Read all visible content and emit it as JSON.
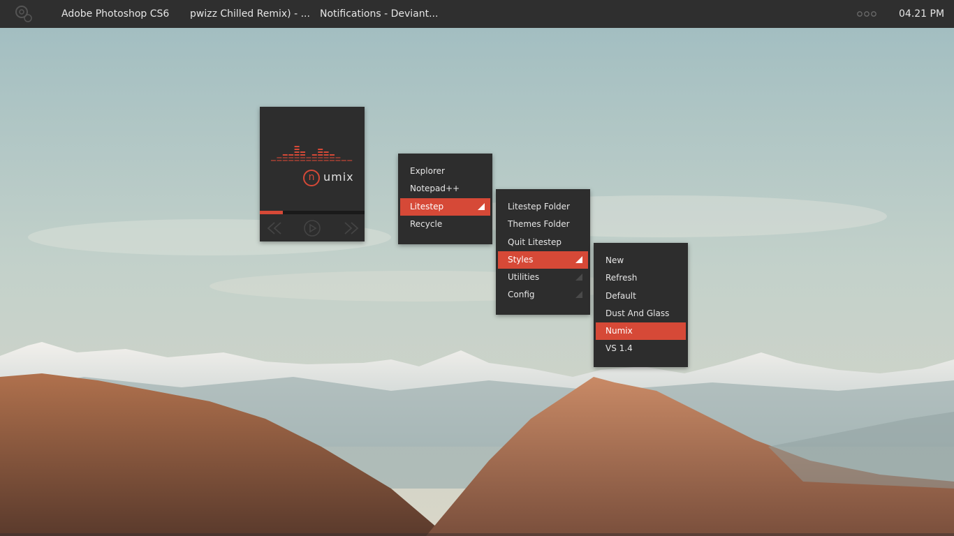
{
  "topbar": {
    "tasks": [
      "Adobe Photoshop CS6",
      "pwizz Chilled Remix) - ...",
      "Notifications - Deviant..."
    ],
    "clock": "04.21 PM",
    "logo_icon": "gears-icon",
    "tray_icon": "three-dots-icon"
  },
  "player": {
    "brand_letter": "n",
    "brand_text": "umix",
    "progress": 0.22,
    "controls": [
      "previous-icon",
      "play-icon",
      "next-icon"
    ]
  },
  "menus": {
    "main": [
      {
        "label": "Explorer"
      },
      {
        "label": "Notepad++"
      },
      {
        "label": "Litestep",
        "active": true,
        "submenu": true
      },
      {
        "label": "Recycle"
      }
    ],
    "litestep": [
      {
        "label": "Litestep Folder"
      },
      {
        "label": "Themes Folder"
      },
      {
        "label": "Quit Litestep"
      },
      {
        "label": "Styles",
        "active": true,
        "submenu": true
      },
      {
        "label": "Utilities",
        "submenu": true
      },
      {
        "label": "Config",
        "submenu": true
      }
    ],
    "styles": [
      {
        "label": "New"
      },
      {
        "label": "Refresh"
      },
      {
        "label": "Default"
      },
      {
        "label": "Dust And Glass"
      },
      {
        "label": "Numix",
        "active": true
      },
      {
        "label": "VS 1.4"
      }
    ]
  },
  "colors": {
    "accent": "#d64937",
    "panel": "#2d2d2d",
    "topbar": "#2f2f2f",
    "text": "#e6e6e6"
  }
}
